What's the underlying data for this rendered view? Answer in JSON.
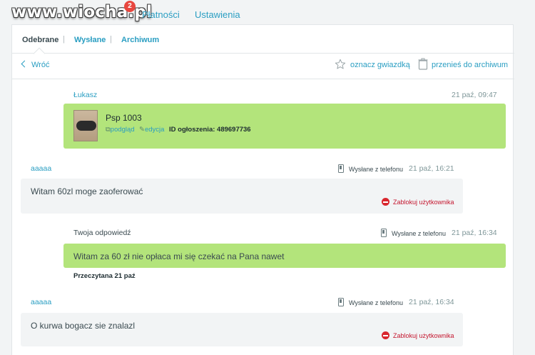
{
  "watermark": {
    "text": "www.wiocha.pl"
  },
  "topnav": {
    "tabs": [
      {
        "label": "Płatności"
      },
      {
        "label": "Ustawienia"
      }
    ],
    "badge_count": "2"
  },
  "subtabs": {
    "received": "Odebrane",
    "sent": "Wysłane",
    "archive": "Archiwum",
    "separator": "|"
  },
  "actions": {
    "back": "Wróć",
    "star": "oznacz gwiazdką",
    "archive": "przenieś do archiwum"
  },
  "conversation": {
    "ad_message": {
      "author": "Łukasz",
      "time": "21 paź, 09:47",
      "ad_title": "Psp 1003",
      "preview_link": "podgląd",
      "edit_link": "edycja",
      "ad_id": "ID ogłoszenia: 489697736"
    },
    "msg1": {
      "author": "aaaaa",
      "device": "Wysłane z telefonu",
      "time": "21 paź, 16:21",
      "text": "Witam 60zl moge zaoferować",
      "block": "Zablokuj użytkownika"
    },
    "reply": {
      "author": "Twoja odpowiedź",
      "device": "Wysłane z telefonu",
      "time": "21 paź, 16:34",
      "text": "Witam za 60 zł nie opłaca mi się czekać na Pana nawet",
      "status": "Przeczytana 21 paź"
    },
    "msg2": {
      "author": "aaaaa",
      "device": "Wysłane z telefonu",
      "time": "21 paź, 16:34",
      "text": "O kurwa bogacz sie znalazl",
      "block": "Zablokuj użytkownika"
    }
  },
  "colors": {
    "accent": "#2a9ec2",
    "green_bubble": "#b3e47b",
    "grey_bubble": "#f2f4f5",
    "block_red": "#c4162e",
    "badge_red": "#e8473f"
  }
}
